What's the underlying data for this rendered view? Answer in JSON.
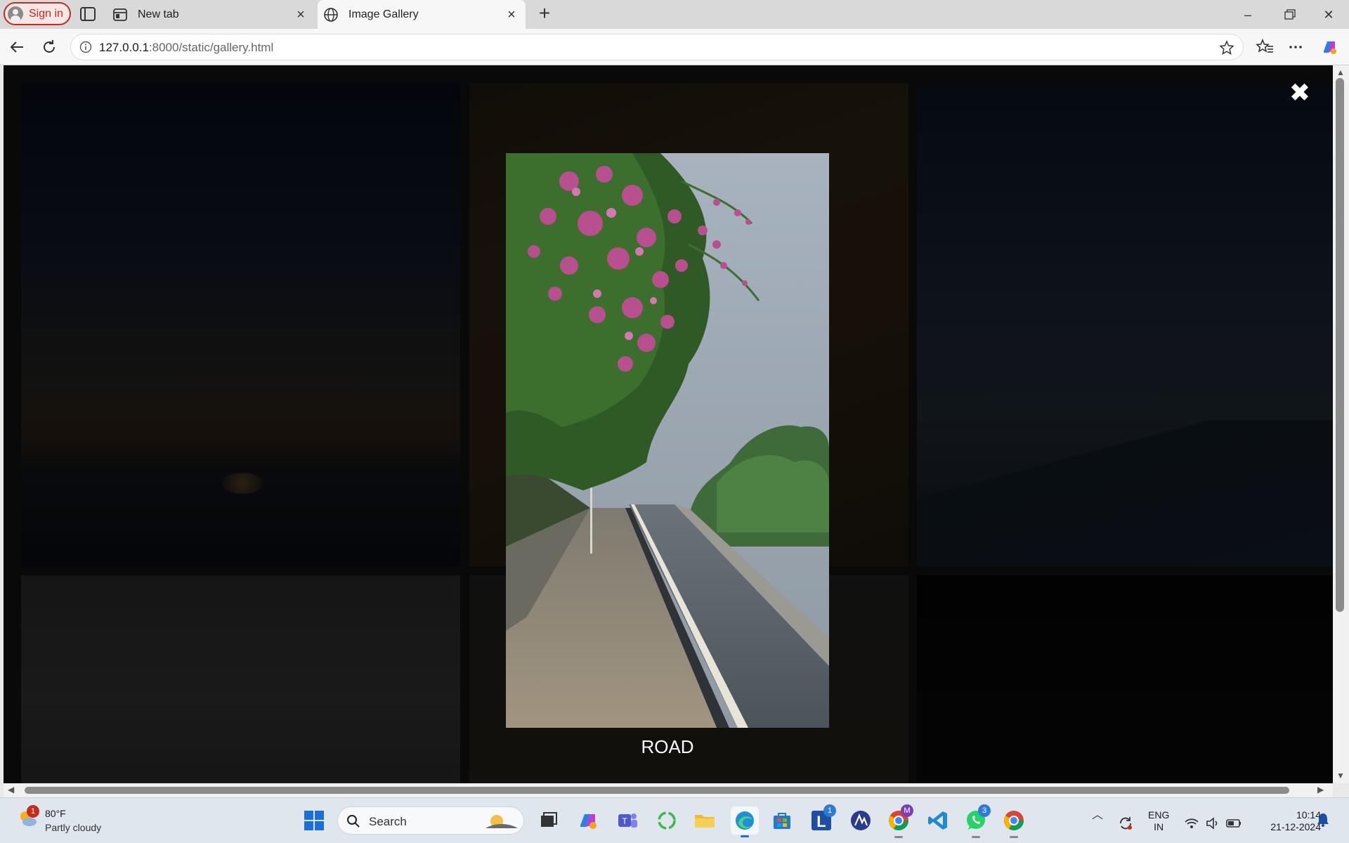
{
  "browser": {
    "sign_in_label": "Sign in",
    "tabs": [
      {
        "title": "New tab",
        "active": false
      },
      {
        "title": "Image Gallery",
        "active": true
      }
    ],
    "address": {
      "host": "127.0.0.1",
      "path": ":8000/static/gallery.html"
    }
  },
  "lightbox": {
    "caption": "ROAD",
    "close_glyph": "✖"
  },
  "gallery": {
    "tiles": [
      "sunset-sea",
      "autumn-foliage",
      "mountain-clouds",
      "branch-silhouette",
      "dark-foliage",
      "night-plant"
    ]
  },
  "taskbar": {
    "weather": {
      "temp": "80°F",
      "desc": "Partly cloudy",
      "badge": "1"
    },
    "search_label": "Search",
    "apps": [
      {
        "name": "task-view"
      },
      {
        "name": "copilot"
      },
      {
        "name": "teams"
      },
      {
        "name": "sync"
      },
      {
        "name": "file-explorer"
      },
      {
        "name": "edge"
      },
      {
        "name": "store"
      },
      {
        "name": "l-app",
        "badge": "1"
      },
      {
        "name": "vector-app"
      },
      {
        "name": "chrome-profile"
      },
      {
        "name": "vscode"
      },
      {
        "name": "whatsapp",
        "badge": "3"
      },
      {
        "name": "chrome"
      }
    ],
    "lang_top": "ENG",
    "lang_bottom": "IN",
    "time": "10:14",
    "date": "21-12-2024"
  }
}
